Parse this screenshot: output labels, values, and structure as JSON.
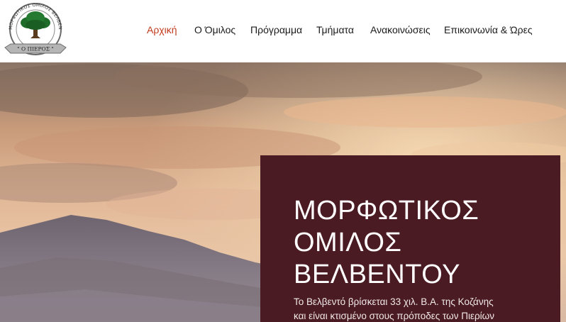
{
  "logo": {
    "ring_text": "ΜΟΡΦΩΤΙΚΟΣ ΟΜΙΛΟΣ ΒΕΛΒΕΝΤΟΥ",
    "banner_text": "\" Ο ΠΙΕΡΟΣ \""
  },
  "nav": {
    "items": [
      {
        "label": "Αρχική"
      },
      {
        "label": "Ο Όμιλος"
      },
      {
        "label": "Πρόγραμμα"
      },
      {
        "label": "Τμήματα"
      },
      {
        "label": "Ανακοινώσεις"
      },
      {
        "label": "Επικοινωνία & Ώρες"
      }
    ]
  },
  "hero": {
    "title_lines": [
      "ΜΟΡΦΩΤΙΚΟΣ",
      "ΟΜΙΛΟΣ",
      "ΒΕΛΒΕΝΤΟΥ"
    ],
    "text_lines": [
      "Το Βελβεντό βρίσκεται 33 χιλ. Β.Α. της Κοζάνης",
      "και είναι κτισμένο στους πρόποδες των Πιερίων"
    ]
  },
  "colors": {
    "accent": "#c23a1e",
    "panel": "#4a1b22",
    "logo_tree": "#1f6b2a"
  }
}
